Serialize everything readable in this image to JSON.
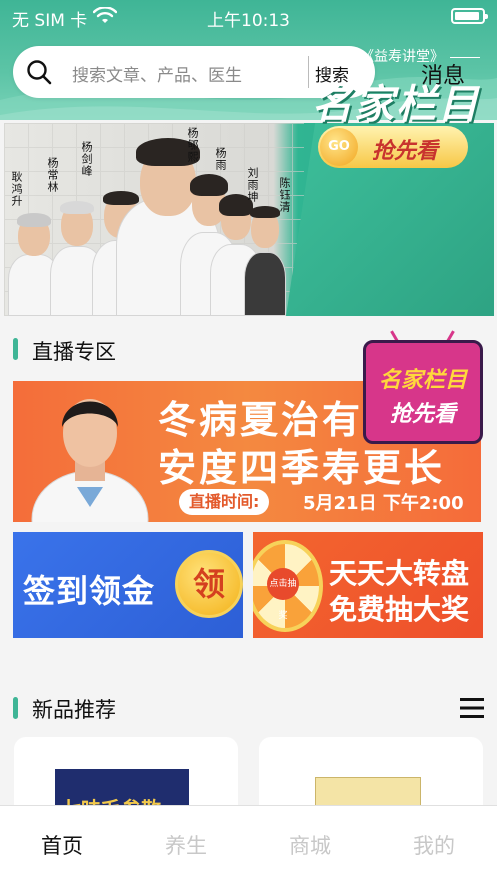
{
  "status_bar": {
    "carrier": "无 SIM 卡",
    "time": "上午10:13"
  },
  "header": {
    "search_placeholder": "搜索文章、产品、医生",
    "search_button": "搜索",
    "messages": "消息"
  },
  "banner": {
    "subtitle": "《益寿讲堂》",
    "title": "名家栏目",
    "go_label": "GO",
    "cta": "抢先看",
    "doctors": [
      "耿鸿升",
      "杨常林",
      "杨剑峰",
      "杨郇熙",
      "杨雨",
      "刘雨坤",
      "陈钰清"
    ]
  },
  "live_section": {
    "title": "直播专区",
    "banner_line1": "冬病夏治有",
    "banner_line2": "安度四季寿更长",
    "time_label": "直播时间:",
    "time_value": "5月21日 下午2:00",
    "badge_line1": "名家栏目",
    "badge_line2": "抢先看"
  },
  "promos": {
    "signin_title": "签到领金",
    "signin_coin": "领",
    "wheel_center": "点击抽奖",
    "wheel_line1": "天天大转盘",
    "wheel_line2": "免费抽大奖"
  },
  "new_products": {
    "title": "新品推荐",
    "product1_label": "七味毛参散"
  },
  "tabs": [
    "首页",
    "养生",
    "商城",
    "我的"
  ],
  "colors": {
    "accent": "#3fb596",
    "live_banner": "#f46d3a",
    "signin": "#3a73ea",
    "wheel": "#ee4f2b"
  }
}
